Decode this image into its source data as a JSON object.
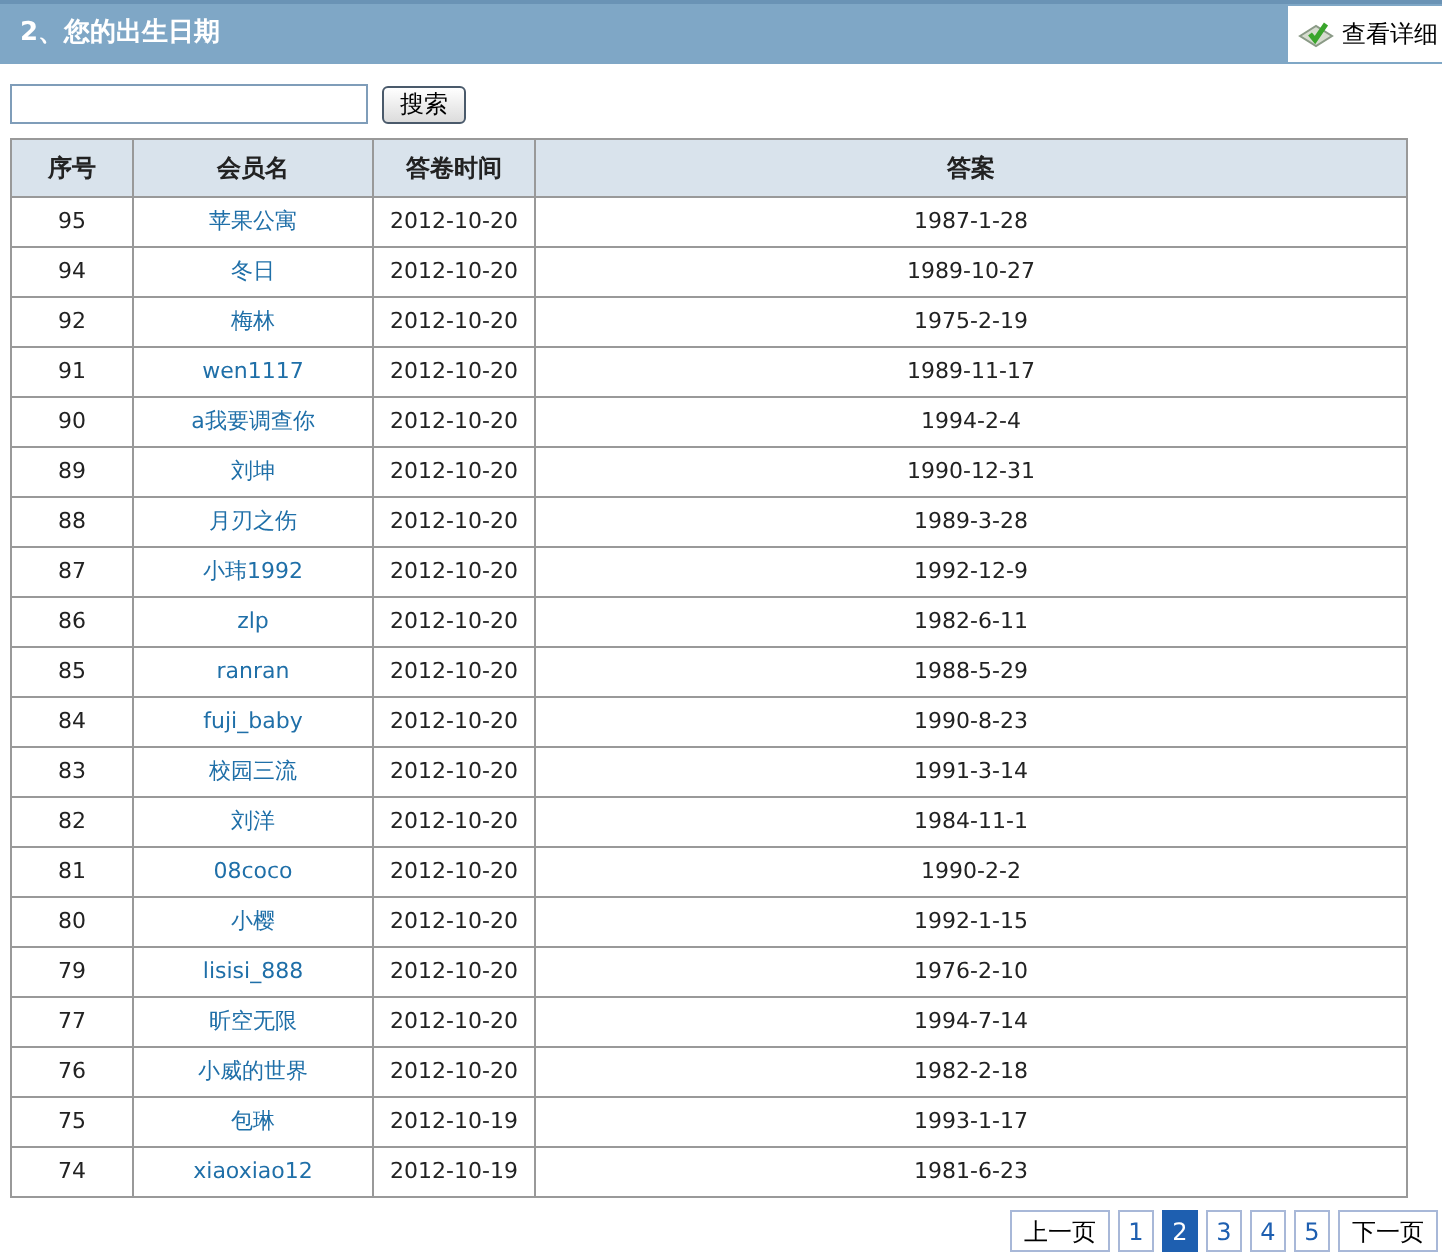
{
  "header": {
    "title": "2、您的出生日期",
    "details_button": "查看详细"
  },
  "search": {
    "button": "搜索"
  },
  "table": {
    "columns": [
      "序号",
      "会员名",
      "答卷时间",
      "答案"
    ],
    "rows": [
      [
        "95",
        "苹果公寓",
        "2012-10-20",
        "1987-1-28"
      ],
      [
        "94",
        "冬日",
        "2012-10-20",
        "1989-10-27"
      ],
      [
        "92",
        "梅林",
        "2012-10-20",
        "1975-2-19"
      ],
      [
        "91",
        "wen1117",
        "2012-10-20",
        "1989-11-17"
      ],
      [
        "90",
        "a我要调查你",
        "2012-10-20",
        "1994-2-4"
      ],
      [
        "89",
        "刘坤",
        "2012-10-20",
        "1990-12-31"
      ],
      [
        "88",
        "月刃之伤",
        "2012-10-20",
        "1989-3-28"
      ],
      [
        "87",
        "小玮1992",
        "2012-10-20",
        "1992-12-9"
      ],
      [
        "86",
        "zlp",
        "2012-10-20",
        "1982-6-11"
      ],
      [
        "85",
        "ranran",
        "2012-10-20",
        "1988-5-29"
      ],
      [
        "84",
        "fuji_baby",
        "2012-10-20",
        "1990-8-23"
      ],
      [
        "83",
        "校园三流",
        "2012-10-20",
        "1991-3-14"
      ],
      [
        "82",
        "刘洋",
        "2012-10-20",
        "1984-11-1"
      ],
      [
        "81",
        "08coco",
        "2012-10-20",
        "1990-2-2"
      ],
      [
        "80",
        "小樱",
        "2012-10-20",
        "1992-1-15"
      ],
      [
        "79",
        "lisisi_888",
        "2012-10-20",
        "1976-2-10"
      ],
      [
        "77",
        "昕空无限",
        "2012-10-20",
        "1994-7-14"
      ],
      [
        "76",
        "小威的世界",
        "2012-10-20",
        "1982-2-18"
      ],
      [
        "75",
        "包琳",
        "2012-10-19",
        "1993-1-17"
      ],
      [
        "74",
        "xiaoxiao12",
        "2012-10-19",
        "1981-6-23"
      ]
    ]
  },
  "pagination": {
    "prev": "上一页",
    "pages": [
      {
        "label": "1",
        "selected": false
      },
      {
        "label": "2",
        "selected": true
      },
      {
        "label": "3",
        "selected": false
      },
      {
        "label": "4",
        "selected": false
      },
      {
        "label": "5",
        "selected": false
      }
    ],
    "next": "下一页"
  }
}
